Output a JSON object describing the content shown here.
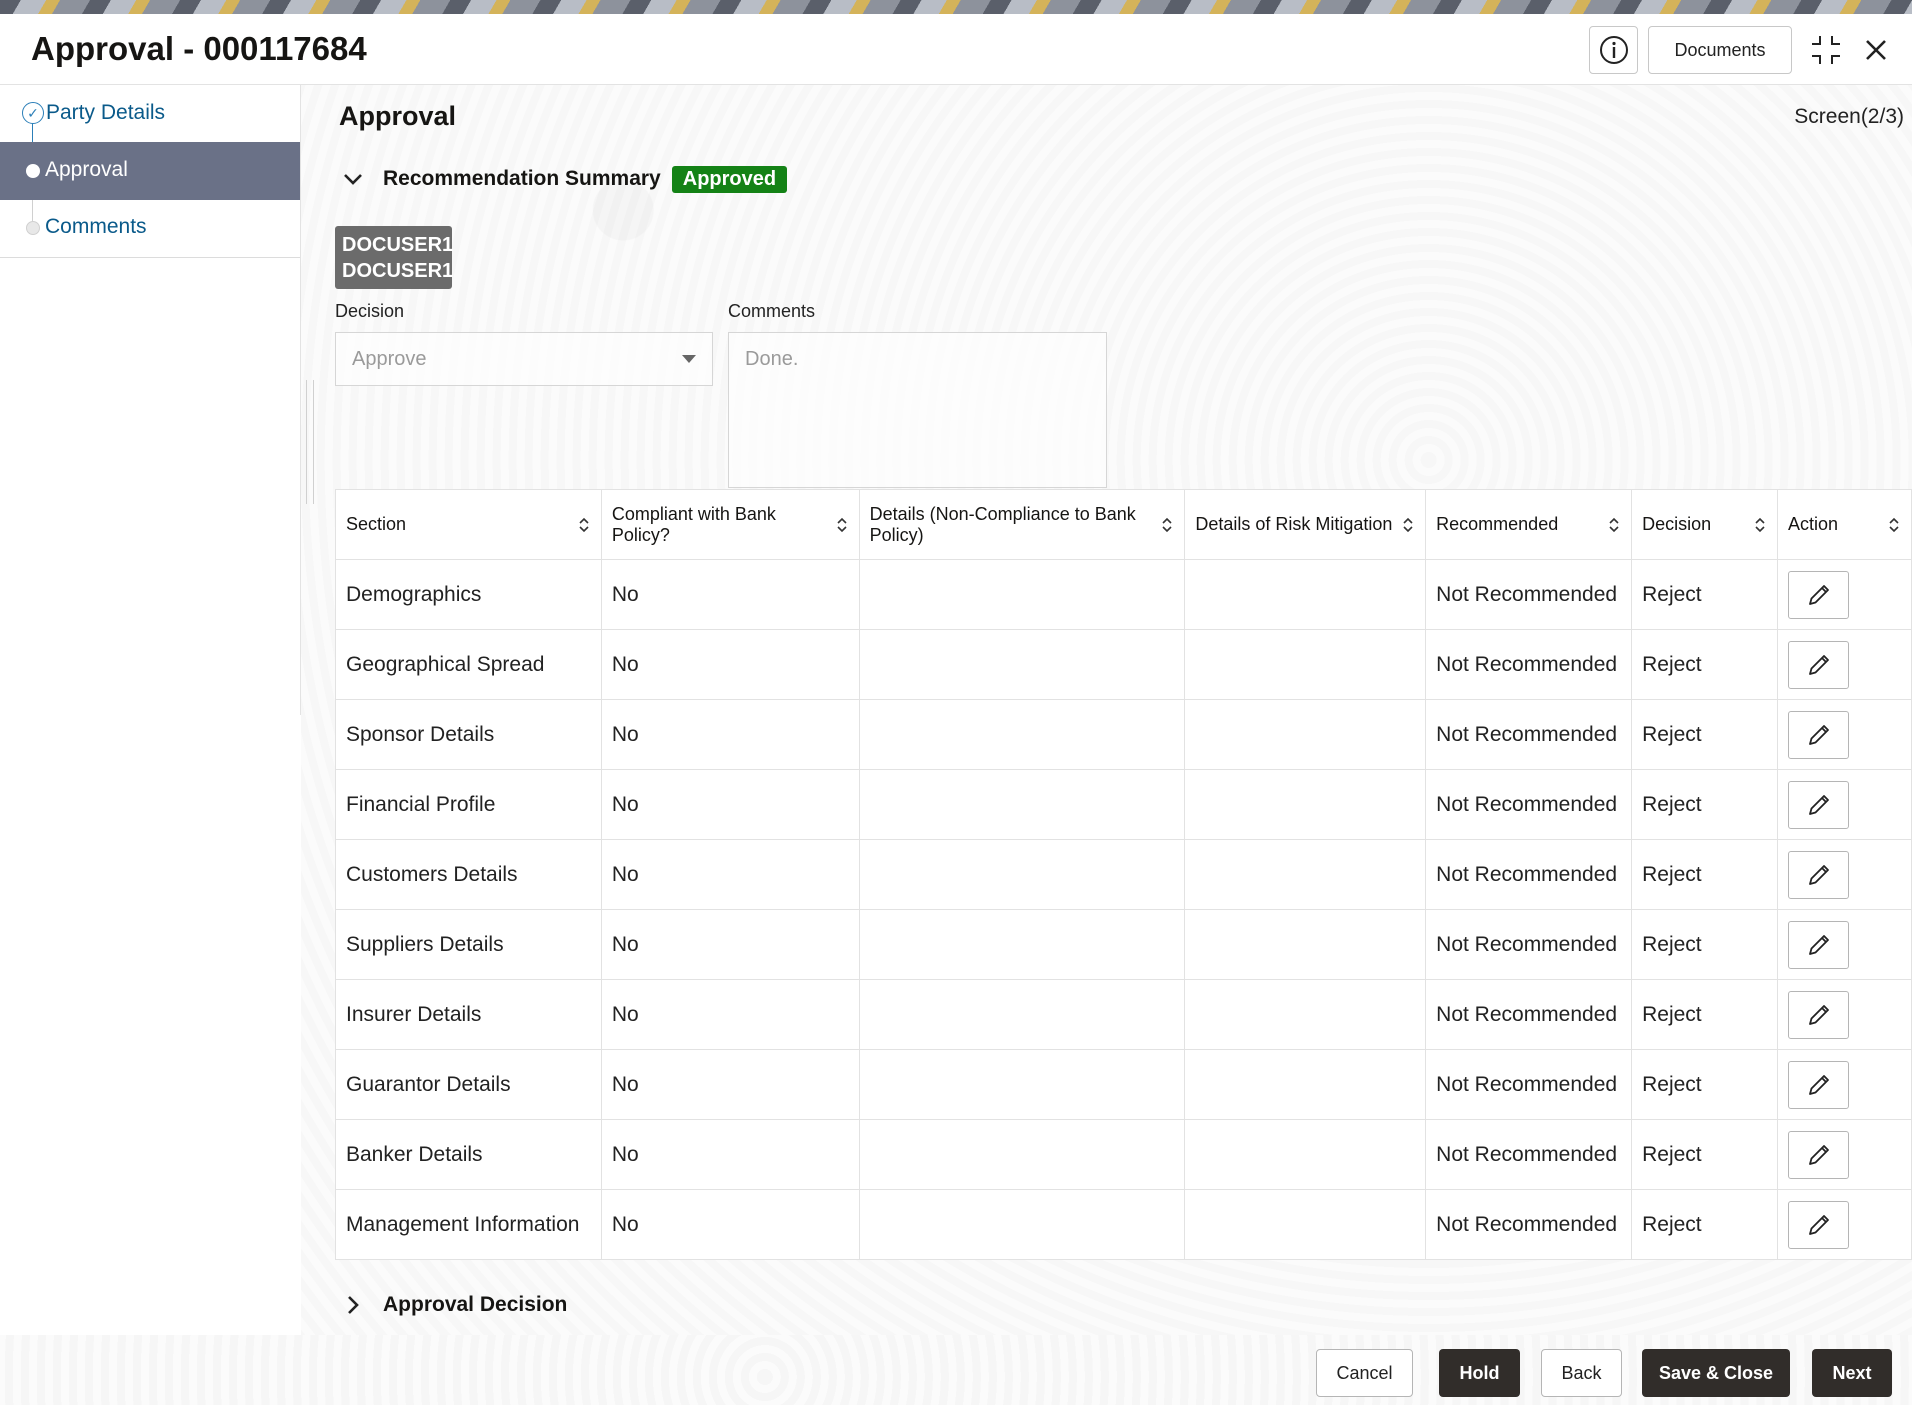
{
  "header": {
    "title": "Approval - 000117684",
    "documents_label": "Documents"
  },
  "sidebar": {
    "items": [
      {
        "label": "Party Details",
        "state": "completed"
      },
      {
        "label": "Approval",
        "state": "active"
      },
      {
        "label": "Comments",
        "state": "pending"
      }
    ]
  },
  "main": {
    "title": "Approval",
    "screen_indicator": "Screen(2/3)",
    "recommendation_summary": {
      "label": "Recommendation Summary",
      "status": "Approved",
      "user_line1": "DOCUSER1",
      "user_line2": "DOCUSER1",
      "decision_label": "Decision",
      "decision_value": "Approve",
      "comments_label": "Comments",
      "comments_value": "Done."
    },
    "table": {
      "columns": [
        "Section",
        "Compliant with Bank Policy?",
        "Details (Non-Compliance to Bank Policy)",
        "Details of Risk Mitigation",
        "Recommended",
        "Decision",
        "Action"
      ],
      "rows": [
        {
          "section": "Demographics",
          "compliant": "No",
          "details": "",
          "risk": "",
          "recommended": "Not Recommended",
          "decision": "Reject"
        },
        {
          "section": "Geographical Spread",
          "compliant": "No",
          "details": "",
          "risk": "",
          "recommended": "Not Recommended",
          "decision": "Reject"
        },
        {
          "section": "Sponsor Details",
          "compliant": "No",
          "details": "",
          "risk": "",
          "recommended": "Not Recommended",
          "decision": "Reject"
        },
        {
          "section": "Financial Profile",
          "compliant": "No",
          "details": "",
          "risk": "",
          "recommended": "Not Recommended",
          "decision": "Reject"
        },
        {
          "section": "Customers Details",
          "compliant": "No",
          "details": "",
          "risk": "",
          "recommended": "Not Recommended",
          "decision": "Reject"
        },
        {
          "section": "Suppliers Details",
          "compliant": "No",
          "details": "",
          "risk": "",
          "recommended": "Not Recommended",
          "decision": "Reject"
        },
        {
          "section": "Insurer Details",
          "compliant": "No",
          "details": "",
          "risk": "",
          "recommended": "Not Recommended",
          "decision": "Reject"
        },
        {
          "section": "Guarantor Details",
          "compliant": "No",
          "details": "",
          "risk": "",
          "recommended": "Not Recommended",
          "decision": "Reject"
        },
        {
          "section": "Banker Details",
          "compliant": "No",
          "details": "",
          "risk": "",
          "recommended": "Not Recommended",
          "decision": "Reject"
        },
        {
          "section": "Management Information",
          "compliant": "No",
          "details": "",
          "risk": "",
          "recommended": "Not Recommended",
          "decision": "Reject"
        }
      ]
    },
    "approval_decision": {
      "label": "Approval Decision"
    }
  },
  "footer": {
    "cancel": "Cancel",
    "hold": "Hold",
    "back": "Back",
    "save_close": "Save & Close",
    "next": "Next"
  },
  "colors": {
    "approved_badge": "#148216",
    "active_nav": "#6a7187",
    "primary_button": "#312d2a",
    "link": "#0a5a8a"
  },
  "icons": [
    "info-icon",
    "minimize-icon",
    "close-icon",
    "chevron-down-icon",
    "chevron-right-icon",
    "sort-icon",
    "edit-pencil-icon",
    "check-circle-icon"
  ]
}
